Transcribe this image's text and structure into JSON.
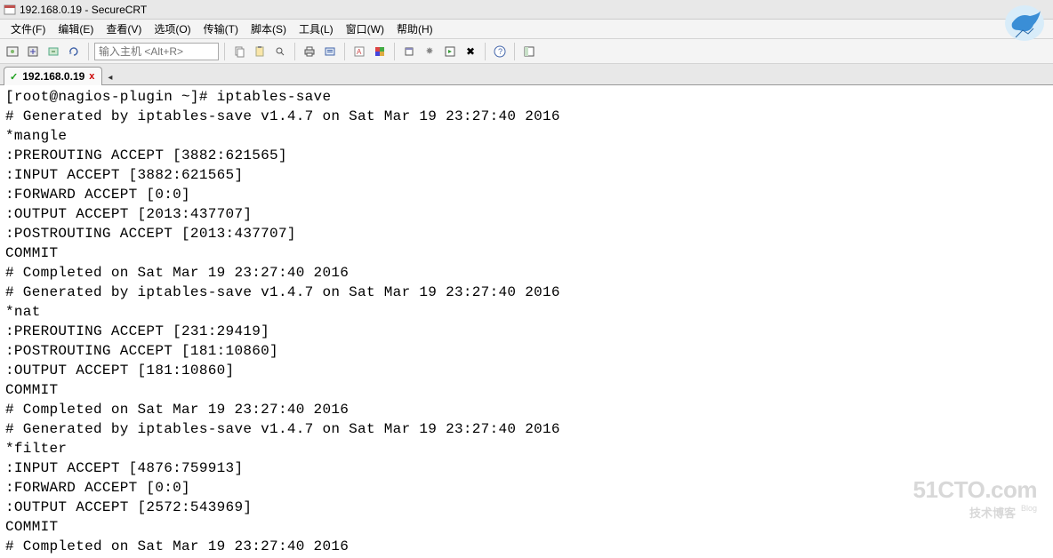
{
  "title": "192.168.0.19 - SecureCRT",
  "menu": {
    "file": "文件(F)",
    "edit": "编辑(E)",
    "view": "查看(V)",
    "options": "选项(O)",
    "transfer": "传输(T)",
    "script": "脚本(S)",
    "tools": "工具(L)",
    "window": "窗口(W)",
    "help": "帮助(H)"
  },
  "toolbar": {
    "host_placeholder": "输入主机 <Alt+R>"
  },
  "tab": {
    "label": "192.168.0.19",
    "close": "x",
    "check": "✓"
  },
  "terminal_lines": [
    "[root@nagios-plugin ~]# iptables-save",
    "# Generated by iptables-save v1.4.7 on Sat Mar 19 23:27:40 2016",
    "*mangle",
    ":PREROUTING ACCEPT [3882:621565]",
    ":INPUT ACCEPT [3882:621565]",
    ":FORWARD ACCEPT [0:0]",
    ":OUTPUT ACCEPT [2013:437707]",
    ":POSTROUTING ACCEPT [2013:437707]",
    "COMMIT",
    "# Completed on Sat Mar 19 23:27:40 2016",
    "# Generated by iptables-save v1.4.7 on Sat Mar 19 23:27:40 2016",
    "*nat",
    ":PREROUTING ACCEPT [231:29419]",
    ":POSTROUTING ACCEPT [181:10860]",
    ":OUTPUT ACCEPT [181:10860]",
    "COMMIT",
    "# Completed on Sat Mar 19 23:27:40 2016",
    "# Generated by iptables-save v1.4.7 on Sat Mar 19 23:27:40 2016",
    "*filter",
    ":INPUT ACCEPT [4876:759913]",
    ":FORWARD ACCEPT [0:0]",
    ":OUTPUT ACCEPT [2572:543969]",
    "COMMIT",
    "# Completed on Sat Mar 19 23:27:40 2016"
  ],
  "watermark": {
    "big": "51CTO.com",
    "small": "技术博客",
    "blog": "Blog"
  }
}
